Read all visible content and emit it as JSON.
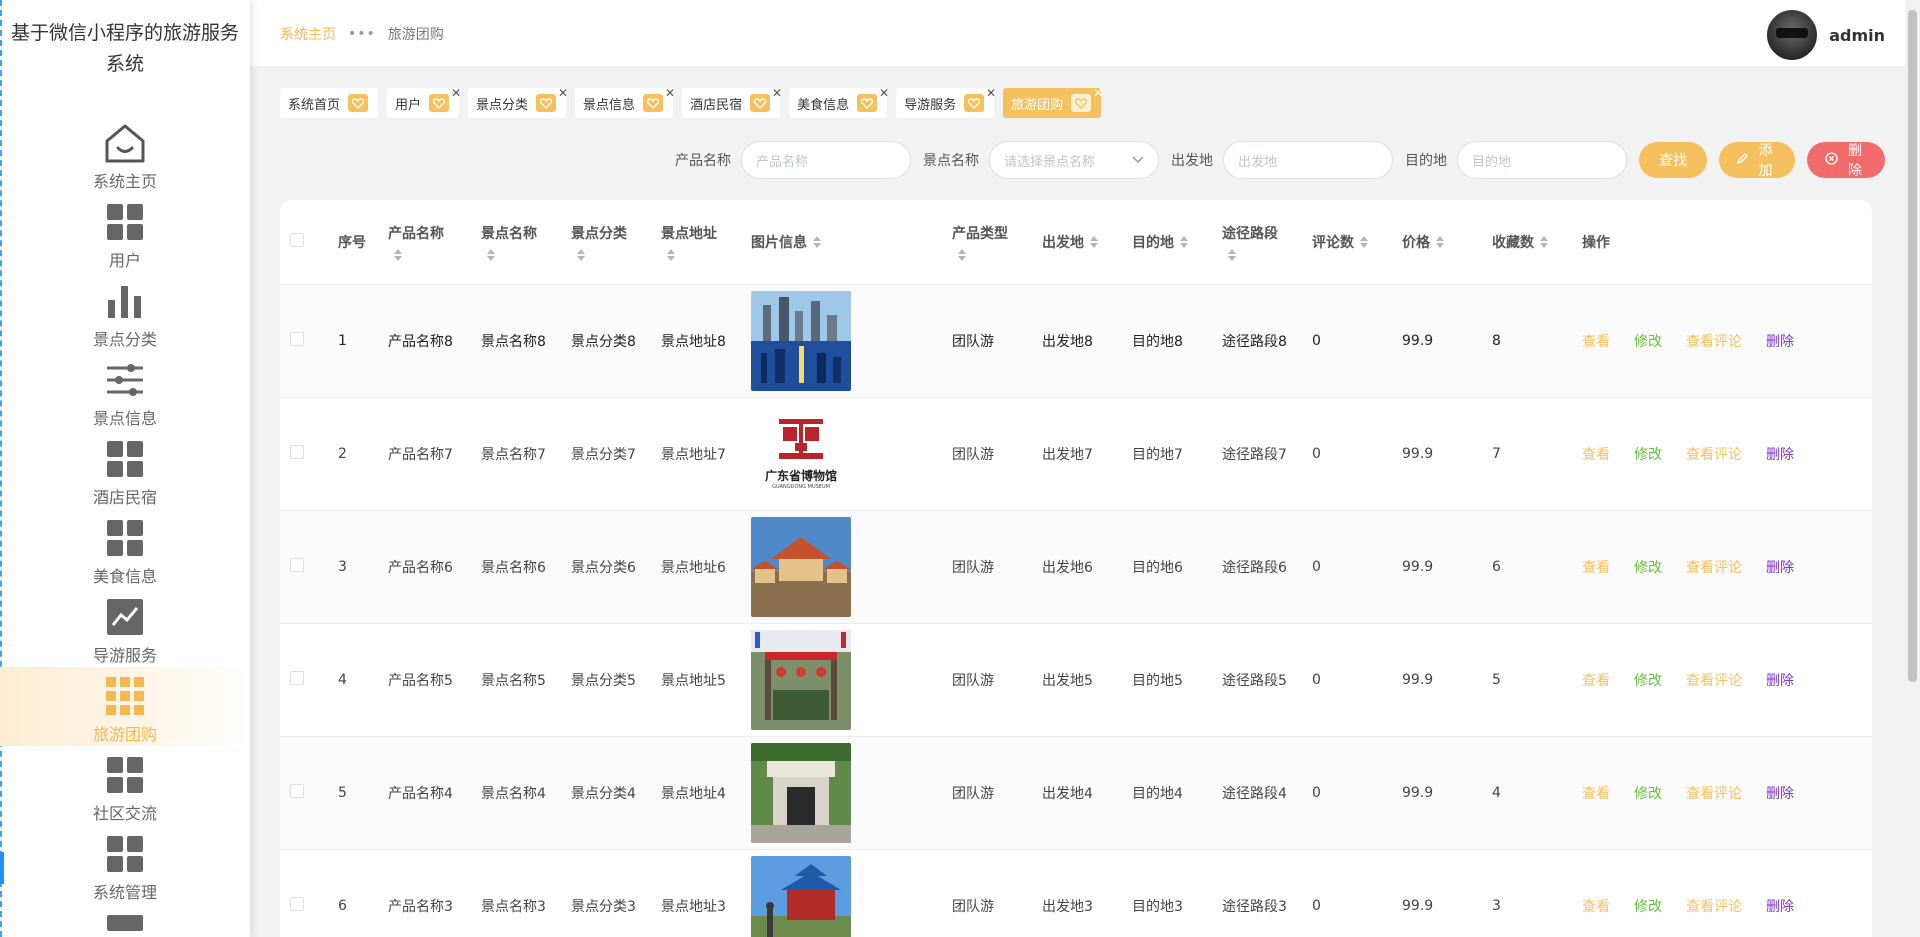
{
  "app": {
    "title": "基于微信小程序的旅游服务系统"
  },
  "sidebar": {
    "items": [
      {
        "label": "系统主页",
        "icon": "house-icon",
        "active": false
      },
      {
        "label": "用户",
        "icon": "grid-icon",
        "active": false
      },
      {
        "label": "景点分类",
        "icon": "bar-chart-icon",
        "active": false
      },
      {
        "label": "景点信息",
        "icon": "sliders-icon",
        "active": false
      },
      {
        "label": "酒店民宿",
        "icon": "grid-icon",
        "active": false
      },
      {
        "label": "美食信息",
        "icon": "grid-icon",
        "active": false
      },
      {
        "label": "导游服务",
        "icon": "line-chart-icon",
        "active": false
      },
      {
        "label": "旅游团购",
        "icon": "nine-grid-icon",
        "active": true
      },
      {
        "label": "社区交流",
        "icon": "grid-icon",
        "active": false
      },
      {
        "label": "系统管理",
        "icon": "grid-icon",
        "active": false
      }
    ]
  },
  "header": {
    "breadcrumb": {
      "home": "系统主页",
      "separator": "•••",
      "current": "旅游团购"
    },
    "username": "admin"
  },
  "tags": [
    {
      "label": "系统首页",
      "closable": false,
      "active": false
    },
    {
      "label": "用户",
      "closable": true,
      "active": false
    },
    {
      "label": "景点分类",
      "closable": true,
      "active": false
    },
    {
      "label": "景点信息",
      "closable": true,
      "active": false
    },
    {
      "label": "酒店民宿",
      "closable": true,
      "active": false
    },
    {
      "label": "美食信息",
      "closable": true,
      "active": false
    },
    {
      "label": "导游服务",
      "closable": true,
      "active": false
    },
    {
      "label": "旅游团购",
      "closable": true,
      "active": true
    }
  ],
  "search": {
    "product_label": "产品名称",
    "product_placeholder": "产品名称",
    "spot_label": "景点名称",
    "spot_placeholder": "请选择景点名称",
    "from_label": "出发地",
    "from_placeholder": "出发地",
    "to_label": "目的地",
    "to_placeholder": "目的地",
    "btn_search": "查找",
    "btn_add": "添加",
    "btn_delete": "删除"
  },
  "table": {
    "columns": [
      "序号",
      "产品名称",
      "景点名称",
      "景点分类",
      "景点地址",
      "图片信息",
      "产品类型",
      "出发地",
      "目的地",
      "途径路段",
      "评论数",
      "价格",
      "收藏数",
      "操作"
    ],
    "actions": {
      "view": "查看",
      "edit": "修改",
      "review": "查看评论",
      "delete": "删除"
    },
    "rows": [
      {
        "no": "1",
        "product": "产品名称8",
        "spot": "景点名称8",
        "category": "景点分类8",
        "address": "景点地址8",
        "image": "city-skyline",
        "type": "团队游",
        "from": "出发地8",
        "to": "目的地8",
        "route": "途径路段8",
        "comments": "0",
        "price": "99.9",
        "favorites": "8"
      },
      {
        "no": "2",
        "product": "产品名称7",
        "spot": "景点名称7",
        "category": "景点分类7",
        "address": "景点地址7",
        "image": "museum-logo",
        "image_text": "广东省博物馆",
        "image_subtext": "GUANGDONG MUSEUM",
        "type": "团队游",
        "from": "出发地7",
        "to": "目的地7",
        "route": "途径路段7",
        "comments": "0",
        "price": "99.9",
        "favorites": "7"
      },
      {
        "no": "3",
        "product": "产品名称6",
        "spot": "景点名称6",
        "category": "景点分类6",
        "address": "景点地址6",
        "image": "temple",
        "type": "团队游",
        "from": "出发地6",
        "to": "目的地6",
        "route": "途径路段6",
        "comments": "0",
        "price": "99.9",
        "favorites": "6"
      },
      {
        "no": "4",
        "product": "产品名称5",
        "spot": "景点名称5",
        "category": "景点分类5",
        "address": "景点地址5",
        "image": "gate-flags",
        "type": "团队游",
        "from": "出发地5",
        "to": "目的地5",
        "route": "途径路段5",
        "comments": "0",
        "price": "99.9",
        "favorites": "5"
      },
      {
        "no": "5",
        "product": "产品名称4",
        "spot": "景点名称4",
        "category": "景点分类4",
        "address": "景点地址4",
        "image": "memorial-gate",
        "type": "团队游",
        "from": "出发地4",
        "to": "目的地4",
        "route": "途径路段4",
        "comments": "0",
        "price": "99.9",
        "favorites": "4"
      },
      {
        "no": "6",
        "product": "产品名称3",
        "spot": "景点名称3",
        "category": "景点分类3",
        "address": "景点地址3",
        "image": "memorial-hall",
        "type": "团队游",
        "from": "出发地3",
        "to": "目的地3",
        "route": "途径路段3",
        "comments": "0",
        "price": "99.9",
        "favorites": "3"
      }
    ]
  },
  "colors": {
    "accent": "#f5c15f",
    "edit": "#67c23a",
    "delete": "#7b39d6",
    "danger": "#f36b6b"
  }
}
